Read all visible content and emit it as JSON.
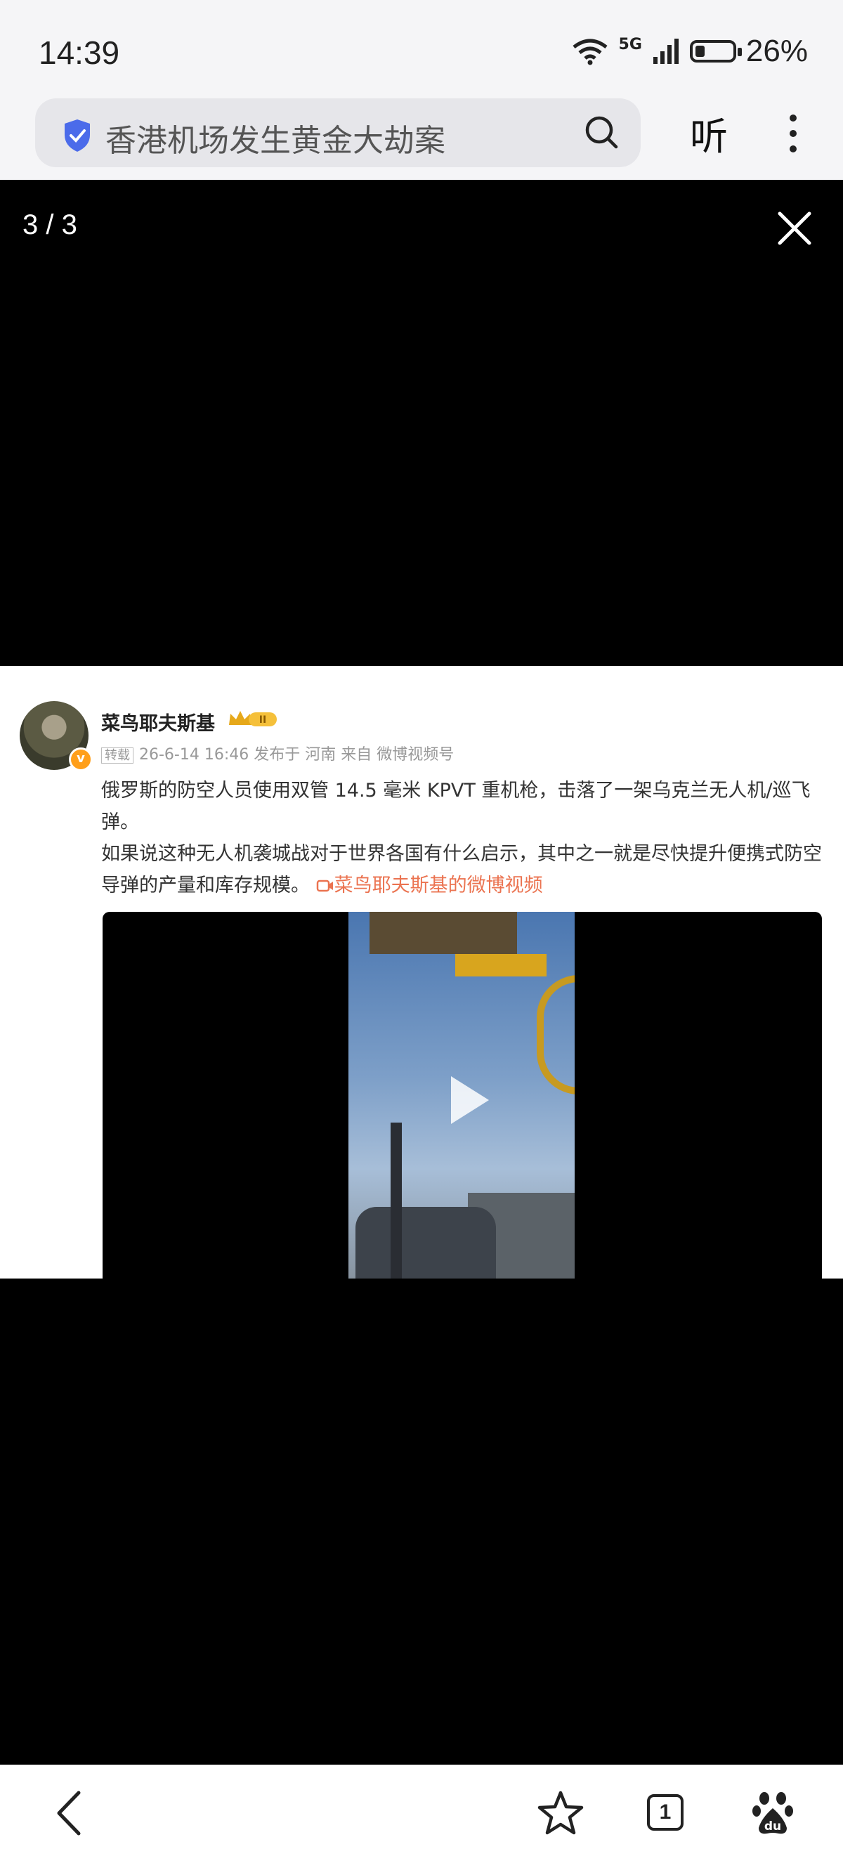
{
  "status_bar": {
    "time": "14:39",
    "network": "5G",
    "battery_percent": "26%",
    "battery_level": 0.26
  },
  "browser": {
    "search_text": "香港机场发生黄金大劫案",
    "listen_label": "听",
    "tab_count": "1"
  },
  "viewer": {
    "counter": "3 / 3"
  },
  "post": {
    "author": "菜鸟耶夫斯基",
    "badge_level": "II",
    "meta_tag": "转载",
    "meta_text": "26-6-14 16:46 发布于 河南 来自 微博视频号",
    "text_line1": "俄罗斯的防空人员使用双管 14.5 毫米 KPVT 重机枪，击落了一架乌克兰无人机/巡飞弹。",
    "text_line2": "如果说这种无人机袭城战对于世界各国有什么启示，其中之一就是尽快提升便携式防空导弹的产量和库存规模。",
    "video_link": "菜鸟耶夫斯基的微博视频"
  },
  "colors": {
    "accent_link": "#eb7350",
    "shield": "#4b6bea",
    "badge": "#ff9f1a"
  }
}
